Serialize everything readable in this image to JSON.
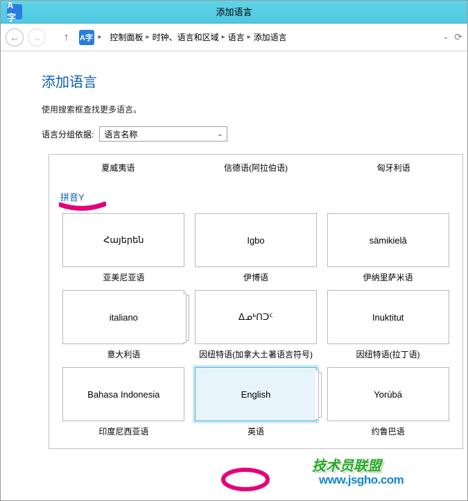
{
  "window": {
    "title": "添加语言",
    "app_icon_glyph": "A字"
  },
  "nav": {
    "crumbs": [
      "控制面板",
      "时钟、语言和区域",
      "语言",
      "添加语言"
    ]
  },
  "page": {
    "title": "添加语言",
    "help": "使用搜索框查找更多语言。",
    "group_label": "语言分组依据:",
    "group_value": "语言名称"
  },
  "prev_section": {
    "items": [
      "夏威夷语",
      "信德语(阿拉伯语)",
      "匈牙利语"
    ]
  },
  "section": {
    "label": "拼音Y"
  },
  "tiles": [
    {
      "native": "Հայերեն",
      "label": "亚美尼亚语",
      "stacked": false,
      "selected": false
    },
    {
      "native": "Igbo",
      "label": "伊博语",
      "stacked": false,
      "selected": false
    },
    {
      "native": "sämikielâ",
      "label": "伊纳里萨米语",
      "stacked": false,
      "selected": false
    },
    {
      "native": "italiano",
      "label": "意大利语",
      "stacked": true,
      "selected": false
    },
    {
      "native": "ᐃᓄᒃᑎᑐᑦ",
      "label": "因纽特语(加拿大土著语言符号)",
      "stacked": false,
      "selected": false
    },
    {
      "native": "Inuktitut",
      "label": "因纽特语(拉丁语)",
      "stacked": false,
      "selected": false
    },
    {
      "native": "Bahasa Indonesia",
      "label": "印度尼西亚语",
      "stacked": false,
      "selected": false
    },
    {
      "native": "English",
      "label": "英语",
      "stacked": true,
      "selected": true
    },
    {
      "native": "Yorùbá",
      "label": "约鲁巴语",
      "stacked": false,
      "selected": false
    }
  ],
  "watermarks": {
    "w1": "技术员联盟",
    "w2": "www.jsgho.com"
  }
}
